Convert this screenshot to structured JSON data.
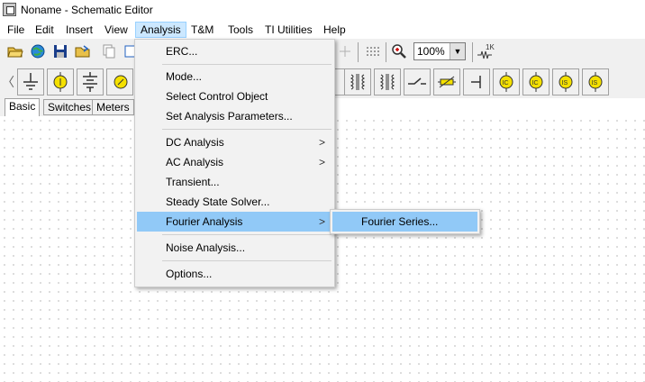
{
  "window": {
    "title": "Noname - Schematic Editor"
  },
  "menubar": {
    "items": [
      {
        "label": "File"
      },
      {
        "label": "Edit"
      },
      {
        "label": "Insert"
      },
      {
        "label": "View"
      },
      {
        "label": "Analysis"
      },
      {
        "label": "T&M"
      },
      {
        "label": "Tools"
      },
      {
        "label": "TI Utilities"
      },
      {
        "label": "Help"
      }
    ]
  },
  "toolbar": {
    "zoom": "100%",
    "icons": [
      "open-icon",
      "globe-icon",
      "save-icon",
      "open-folder-icon",
      "copy-icon",
      "grid-icon",
      "zoom-icon",
      "resistor-tool-icon"
    ]
  },
  "parts_toolbar": {
    "icons": [
      "ground-icon",
      "voltage-source-icon",
      "battery-icon",
      "meter-icon",
      "transformer-icon",
      "transformer2-icon",
      "switch-icon",
      "varistor-icon",
      "capacitor-icon",
      "ic-source-icon",
      "ic-source2-icon",
      "is-source-icon",
      "is-source2-icon"
    ],
    "badges": [
      "IC",
      "IC",
      "IS",
      "IS"
    ]
  },
  "tabs": [
    {
      "label": "Basic"
    },
    {
      "label": "Switches"
    },
    {
      "label": "Meters"
    }
  ],
  "analysis_menu": {
    "items": [
      {
        "label": "ERC..."
      },
      {
        "label": "Mode..."
      },
      {
        "label": "Select Control Object"
      },
      {
        "label": "Set Analysis Parameters..."
      },
      {
        "label": "DC Analysis",
        "arrow": ">"
      },
      {
        "label": "AC Analysis",
        "arrow": ">"
      },
      {
        "label": "Transient..."
      },
      {
        "label": "Steady State Solver..."
      },
      {
        "label": "Fourier Analysis",
        "arrow": ">"
      },
      {
        "label": "Noise Analysis..."
      },
      {
        "label": "Options..."
      }
    ]
  },
  "fourier_submenu": {
    "items": [
      {
        "label": "Fourier Series..."
      }
    ]
  }
}
